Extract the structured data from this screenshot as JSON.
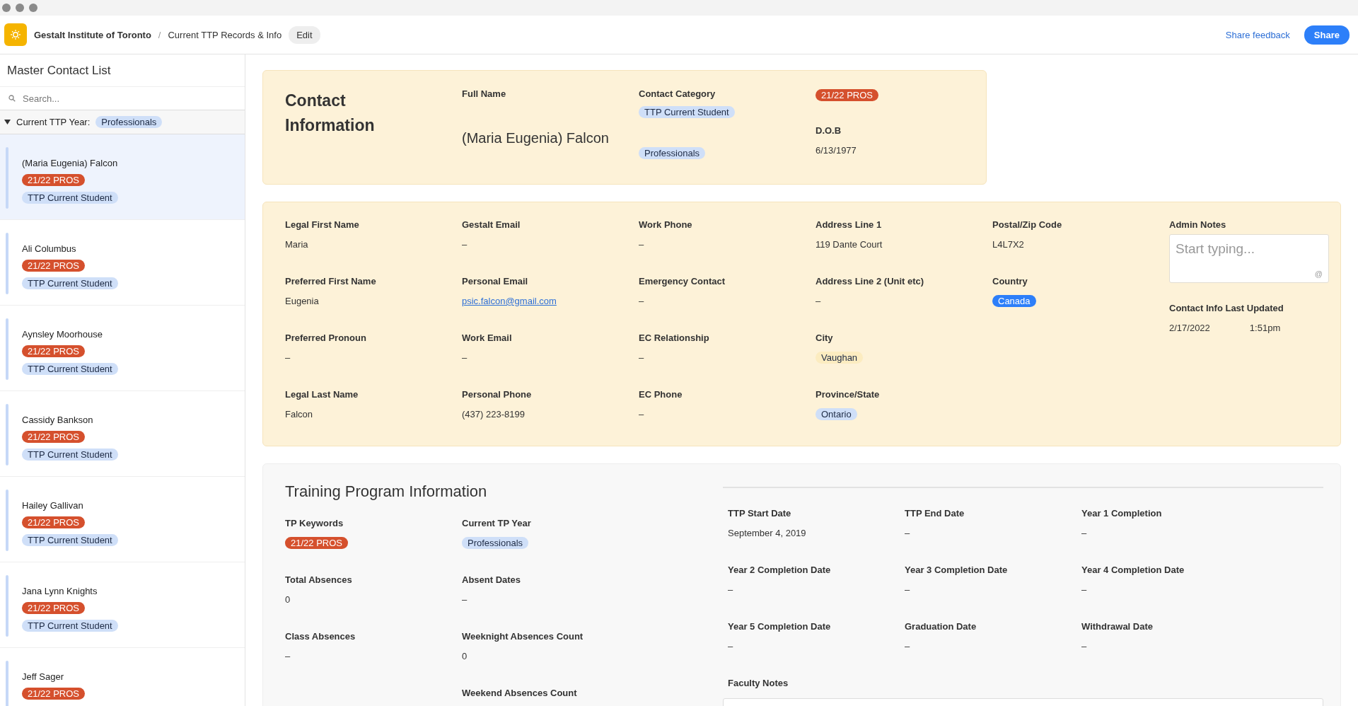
{
  "header": {
    "workspace": "Gestalt Institute of Toronto",
    "separator": "/",
    "page": "Current TTP Records & Info",
    "edit": "Edit",
    "share_feedback": "Share feedback",
    "share": "Share"
  },
  "sidebar": {
    "title": "Master Contact List",
    "search": {
      "placeholder": "Search..."
    },
    "group": {
      "expanded": true,
      "label": "Current TTP Year:",
      "tag": {
        "text": "Professionals",
        "color": "#cfdff8"
      }
    },
    "items": [
      {
        "name": "(Maria Eugenia) Falcon",
        "selected": true,
        "tags": [
          {
            "text": "21/22 PROS",
            "color": "#d5502d"
          },
          {
            "text": "TTP Current Student",
            "color": "#cfdff8"
          }
        ]
      },
      {
        "name": "Ali Columbus",
        "selected": false,
        "tags": [
          {
            "text": "21/22 PROS",
            "color": "#d5502d"
          },
          {
            "text": "TTP Current Student",
            "color": "#cfdff8"
          }
        ]
      },
      {
        "name": "Aynsley Moorhouse",
        "selected": false,
        "tags": [
          {
            "text": "21/22 PROS",
            "color": "#d5502d"
          },
          {
            "text": "TTP Current Student",
            "color": "#cfdff8"
          }
        ]
      },
      {
        "name": "Cassidy Bankson",
        "selected": false,
        "tags": [
          {
            "text": "21/22 PROS",
            "color": "#d5502d"
          },
          {
            "text": "TTP Current Student",
            "color": "#cfdff8"
          }
        ]
      },
      {
        "name": "Hailey Gallivan",
        "selected": false,
        "tags": [
          {
            "text": "21/22 PROS",
            "color": "#d5502d"
          },
          {
            "text": "TTP Current Student",
            "color": "#cfdff8"
          }
        ]
      },
      {
        "name": "Jana Lynn Knights",
        "selected": false,
        "tags": [
          {
            "text": "21/22 PROS",
            "color": "#d5502d"
          },
          {
            "text": "TTP Current Student",
            "color": "#cfdff8"
          }
        ]
      },
      {
        "name": "Jeff Sager",
        "selected": false,
        "tags": [
          {
            "text": "21/22 PROS",
            "color": "#d5502d"
          }
        ]
      }
    ]
  },
  "contact_card": {
    "title": "Contact Information",
    "full_name_label": "Full Name",
    "full_name": "(Maria Eugenia) Falcon",
    "category_label": "Contact Category",
    "category_tags": [
      {
        "text": "TTP Current Student",
        "color": "#cfdff8"
      },
      {
        "text": "Professionals",
        "color": "#cfdff8"
      }
    ],
    "keyword_tag": {
      "text": "21/22 PROS",
      "color": "#d5502d"
    },
    "dob_label": "D.O.B",
    "dob": "6/13/1977"
  },
  "info_card": {
    "columns": [
      [
        {
          "label": "Legal First Name",
          "value": {
            "kind": "text",
            "text": "Maria"
          }
        },
        {
          "label": "Preferred First Name",
          "value": {
            "kind": "text",
            "text": "Eugenia"
          }
        },
        {
          "label": "Preferred Pronoun",
          "value": {
            "kind": "text",
            "text": "–"
          }
        },
        {
          "label": "Legal Last Name",
          "value": {
            "kind": "text",
            "text": "Falcon"
          }
        }
      ],
      [
        {
          "label": "Gestalt Email",
          "value": {
            "kind": "text",
            "text": "–"
          }
        },
        {
          "label": "Personal Email",
          "value": {
            "kind": "link",
            "text": "psic.falcon@gmail.com"
          }
        },
        {
          "label": "Work Email",
          "value": {
            "kind": "text",
            "text": "–"
          }
        },
        {
          "label": "Personal Phone",
          "value": {
            "kind": "text",
            "text": "(437) 223-8199"
          }
        }
      ],
      [
        {
          "label": "Work Phone",
          "value": {
            "kind": "text",
            "text": "–"
          }
        },
        {
          "label": "Emergency Contact",
          "value": {
            "kind": "text",
            "text": "–"
          }
        },
        {
          "label": "EC Relationship",
          "value": {
            "kind": "text",
            "text": "–"
          }
        },
        {
          "label": "EC Phone",
          "value": {
            "kind": "text",
            "text": "–"
          }
        }
      ],
      [
        {
          "label": "Address Line 1",
          "value": {
            "kind": "text",
            "text": "119 Dante Court"
          }
        },
        {
          "label": "Address Line 2 (Unit etc)",
          "value": {
            "kind": "text",
            "text": "–"
          }
        },
        {
          "label": "City",
          "value": {
            "kind": "tag",
            "text": "Vaughan",
            "color": "#fcecc0"
          }
        },
        {
          "label": "Province/State",
          "value": {
            "kind": "tag",
            "text": "Ontario",
            "color": "#cfdff8"
          }
        }
      ],
      [
        {
          "label": "Postal/Zip Code",
          "value": {
            "kind": "text",
            "text": "L4L7X2"
          }
        },
        {
          "label": "Country",
          "value": {
            "kind": "tag",
            "text": "Canada",
            "color": "#2d7ff9"
          }
        }
      ]
    ],
    "admin": {
      "label": "Admin Notes",
      "notes": {
        "placeholder": "Start typing...",
        "mention": "@"
      },
      "updated_label": "Contact Info Last Updated",
      "updated_date": "2/17/2022",
      "updated_time": "1:51pm"
    }
  },
  "training": {
    "title": "Training Program Information",
    "left_columns": [
      [
        {
          "label": "TP Keywords",
          "value": {
            "kind": "tag",
            "text": "21/22 PROS",
            "color": "#d5502d"
          }
        },
        {
          "label": "Total Absences",
          "value": {
            "kind": "text",
            "text": "0"
          }
        },
        {
          "label": "Class Absences",
          "value": {
            "kind": "text",
            "text": "–"
          }
        }
      ],
      [
        {
          "label": "Current TP Year",
          "value": {
            "kind": "tag",
            "text": "Professionals",
            "color": "#cfdff8"
          }
        },
        {
          "label": "Absent Dates",
          "value": {
            "kind": "text",
            "text": "–"
          }
        },
        {
          "label": "Weeknight Absences Count",
          "value": {
            "kind": "text",
            "text": "0"
          }
        },
        {
          "label": "Weekend Absences Count"
        }
      ]
    ],
    "right_fields": [
      {
        "label": "TTP Start Date",
        "value": {
          "kind": "text",
          "text": "September 4, 2019"
        }
      },
      {
        "label": "TTP End Date",
        "value": {
          "kind": "text",
          "text": "–"
        }
      },
      {
        "label": "Year 1 Completion",
        "value": {
          "kind": "text",
          "text": "–"
        }
      },
      {
        "label": "Year 2 Completion Date",
        "value": {
          "kind": "text",
          "text": "–"
        }
      },
      {
        "label": "Year 3 Completion Date",
        "value": {
          "kind": "text",
          "text": "–"
        }
      },
      {
        "label": "Year 4 Completion Date",
        "value": {
          "kind": "text",
          "text": "–"
        }
      },
      {
        "label": "Year 5 Completion Date",
        "value": {
          "kind": "text",
          "text": "–"
        }
      },
      {
        "label": "Graduation Date",
        "value": {
          "kind": "text",
          "text": "–"
        }
      },
      {
        "label": "Withdrawal Date",
        "value": {
          "kind": "text",
          "text": "–"
        }
      }
    ],
    "faculty_notes_label": "Faculty Notes"
  }
}
